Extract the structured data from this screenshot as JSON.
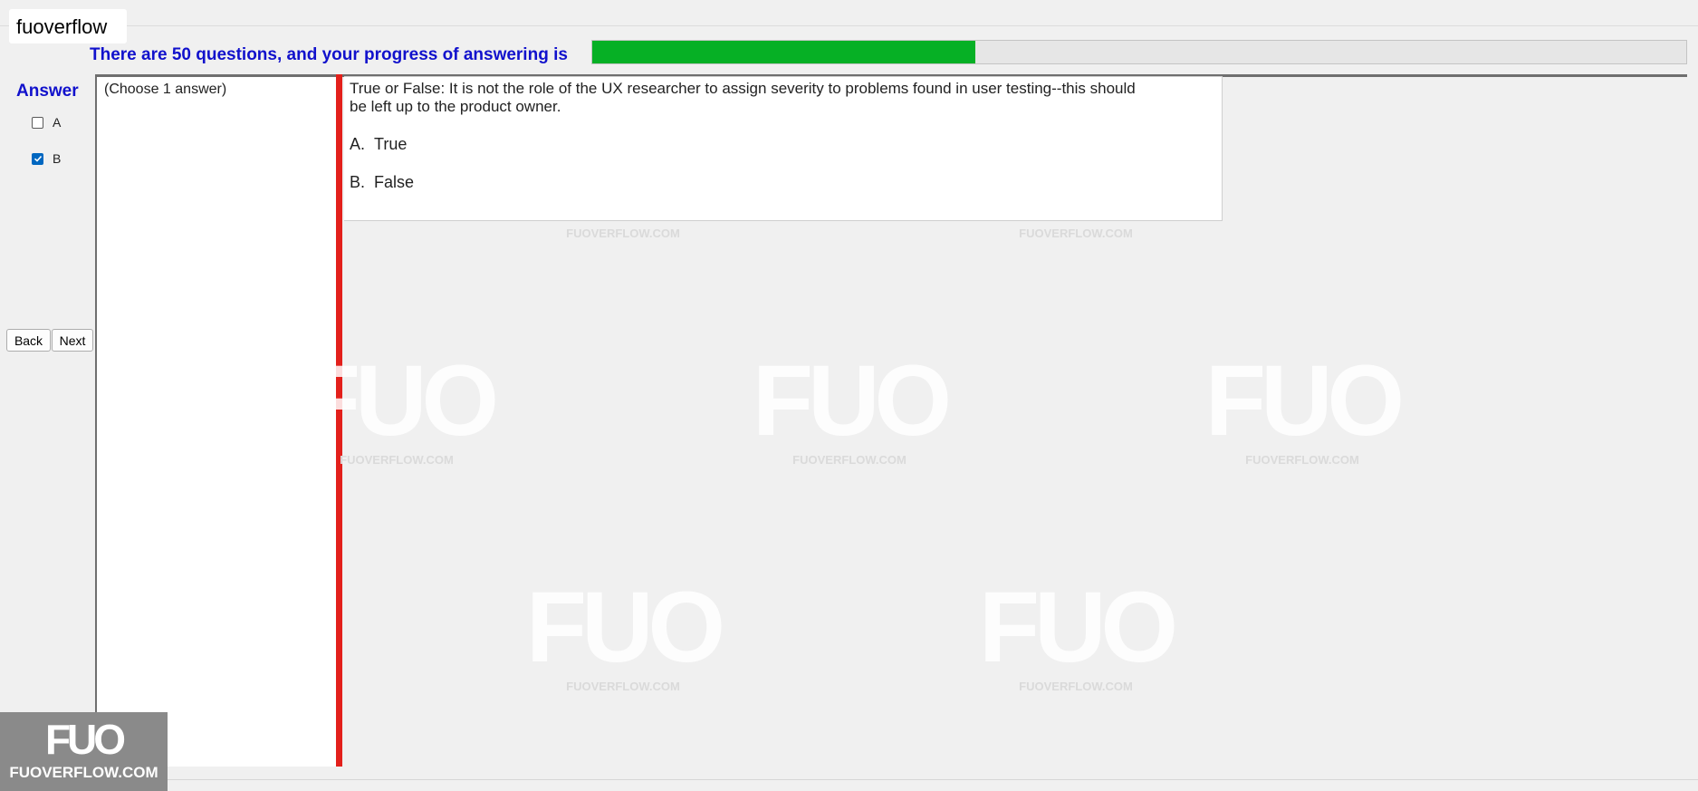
{
  "app": {
    "title": "fuoverflow"
  },
  "progress": {
    "label": "There are 50 questions, and your progress of answering is",
    "fraction": 0.35
  },
  "answer_panel": {
    "heading": "Answer",
    "choices": [
      {
        "label": "A",
        "checked": false
      },
      {
        "label": "B",
        "checked": true
      }
    ]
  },
  "nav": {
    "back_label": "Back",
    "next_label": "Next"
  },
  "instructions": {
    "text": "(Choose 1 answer)"
  },
  "question": {
    "text": "True or False: It is not the role of the UX researcher to assign severity to problems found in user testing--this should be left up to the product owner.",
    "options": [
      {
        "letter": "A.",
        "text": "True"
      },
      {
        "letter": "B.",
        "text": "False"
      }
    ]
  },
  "watermark": {
    "logo": "FUO",
    "site": "FUOVERFLOW.COM"
  },
  "colors": {
    "progress_fill": "#06b025",
    "heading_blue": "#1111cc",
    "splitter_red": "#e3201b",
    "checkbox_checked": "#0067c0"
  }
}
